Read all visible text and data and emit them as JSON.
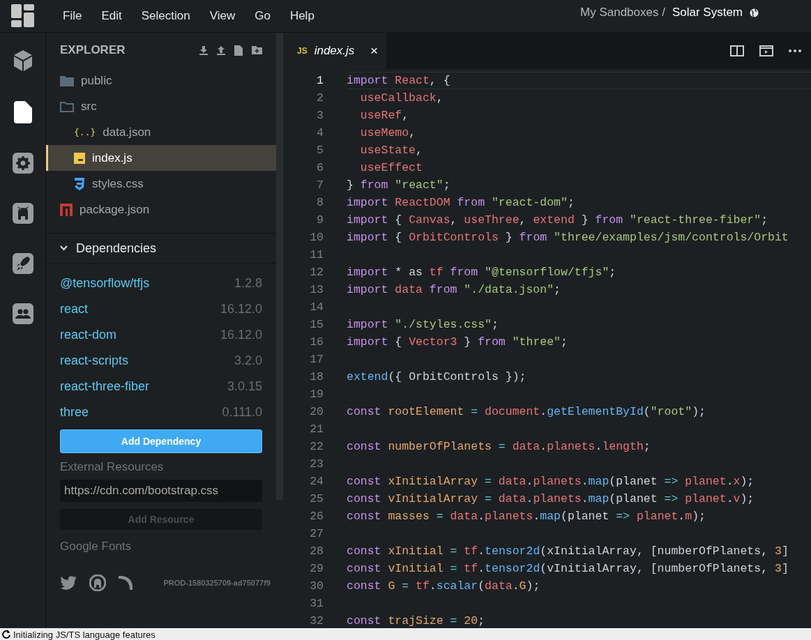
{
  "menu": [
    "File",
    "Edit",
    "Selection",
    "View",
    "Go",
    "Help"
  ],
  "breadcrumb": {
    "parent": "My Sandboxes /",
    "title": "Solar System"
  },
  "activity_bar": [
    {
      "kind": "cube",
      "selected": false
    },
    {
      "kind": "file",
      "selected": true
    },
    {
      "kind": "gear",
      "selected": false
    },
    {
      "kind": "github",
      "selected": false
    },
    {
      "kind": "rocket",
      "selected": false
    },
    {
      "kind": "people",
      "selected": false
    }
  ],
  "explorer": {
    "title": "EXPLORER",
    "files": [
      {
        "name": "public",
        "kind": "folder",
        "expanded": false,
        "selected": false
      },
      {
        "name": "src",
        "kind": "folder",
        "expanded": true,
        "selected": false,
        "children": [
          {
            "name": "data.json",
            "kind": "json",
            "icon_text": "{..}",
            "selected": false
          },
          {
            "name": "index.js",
            "kind": "js",
            "selected": true
          },
          {
            "name": "styles.css",
            "kind": "css",
            "selected": false
          }
        ]
      },
      {
        "name": "package.json",
        "kind": "npm",
        "selected": false
      }
    ]
  },
  "dependencies": {
    "title": "Dependencies",
    "expanded": true,
    "items": [
      {
        "name": "@tensorflow/tfjs",
        "version": "1.2.8"
      },
      {
        "name": "react",
        "version": "16.12.0"
      },
      {
        "name": "react-dom",
        "version": "16.12.0"
      },
      {
        "name": "react-scripts",
        "version": "3.2.0"
      },
      {
        "name": "react-three-fiber",
        "version": "3.0.15"
      },
      {
        "name": "three",
        "version": "0.111.0"
      }
    ],
    "add_button": "Add Dependency"
  },
  "external_resources": {
    "label": "External Resources",
    "placeholder": "https://cdn.com/bootstrap.css",
    "button": "Add Resource",
    "button_disabled": true
  },
  "google_fonts": "Google Fonts",
  "footer": {
    "version": "PROD-1580325709-ad75077f9"
  },
  "editor": {
    "tab": {
      "icon_text": "JS",
      "name": "index.js",
      "close": "×",
      "selected": true
    },
    "lines": [
      {
        "number": "1",
        "current": true,
        "tokens": [
          {
            "text": "import",
            "kind": "keyword"
          },
          {
            "text": " React",
            "kind": "variable"
          },
          {
            "text": ", {",
            "kind": "plain"
          }
        ]
      },
      {
        "number": "2",
        "current": false,
        "tokens": [
          {
            "text": "  useCallback",
            "kind": "variable"
          },
          {
            "text": ",",
            "kind": "plain"
          }
        ]
      },
      {
        "number": "3",
        "current": false,
        "tokens": [
          {
            "text": "  useRef",
            "kind": "variable"
          },
          {
            "text": ",",
            "kind": "plain"
          }
        ]
      },
      {
        "number": "4",
        "current": false,
        "tokens": [
          {
            "text": "  useMemo",
            "kind": "variable"
          },
          {
            "text": ",",
            "kind": "plain"
          }
        ]
      },
      {
        "number": "5",
        "current": false,
        "tokens": [
          {
            "text": "  useState",
            "kind": "variable"
          },
          {
            "text": ",",
            "kind": "plain"
          }
        ]
      },
      {
        "number": "6",
        "current": false,
        "tokens": [
          {
            "text": "  useEffect",
            "kind": "variable"
          }
        ]
      },
      {
        "number": "7",
        "current": false,
        "tokens": [
          {
            "text": "}",
            "kind": "plain"
          },
          {
            "text": " from",
            "kind": "keyword"
          },
          {
            "text": " \"react\"",
            "kind": "string"
          },
          {
            "text": ";",
            "kind": "plain"
          }
        ]
      },
      {
        "number": "8",
        "current": false,
        "tokens": [
          {
            "text": "import",
            "kind": "keyword"
          },
          {
            "text": " ReactDOM",
            "kind": "variable"
          },
          {
            "text": " from",
            "kind": "keyword"
          },
          {
            "text": " \"react-dom\"",
            "kind": "string"
          },
          {
            "text": ";",
            "kind": "plain"
          }
        ]
      },
      {
        "number": "9",
        "current": false,
        "tokens": [
          {
            "text": "import",
            "kind": "keyword"
          },
          {
            "text": " {",
            "kind": "plain"
          },
          {
            "text": " Canvas",
            "kind": "variable"
          },
          {
            "text": ",",
            "kind": "plain"
          },
          {
            "text": " useThree",
            "kind": "variable"
          },
          {
            "text": ",",
            "kind": "plain"
          },
          {
            "text": " extend",
            "kind": "variable"
          },
          {
            "text": " }",
            "kind": "plain"
          },
          {
            "text": " from",
            "kind": "keyword"
          },
          {
            "text": " \"react-three-fiber\"",
            "kind": "string"
          },
          {
            "text": ";",
            "kind": "plain"
          }
        ]
      },
      {
        "number": "10",
        "current": false,
        "tokens": [
          {
            "text": "import",
            "kind": "keyword"
          },
          {
            "text": " {",
            "kind": "plain"
          },
          {
            "text": " OrbitControls",
            "kind": "variable"
          },
          {
            "text": " }",
            "kind": "plain"
          },
          {
            "text": " from",
            "kind": "keyword"
          },
          {
            "text": " \"three/examples/jsm/controls/Orbit",
            "kind": "string"
          }
        ]
      },
      {
        "number": "11",
        "current": false
      },
      {
        "number": "12",
        "current": false,
        "tokens": [
          {
            "text": "import",
            "kind": "keyword"
          },
          {
            "text": " * as",
            "kind": "plain"
          },
          {
            "text": " tf",
            "kind": "variable"
          },
          {
            "text": " from",
            "kind": "keyword"
          },
          {
            "text": " \"@tensorflow/tfjs\"",
            "kind": "string"
          },
          {
            "text": ";",
            "kind": "plain"
          }
        ]
      },
      {
        "number": "13",
        "current": false,
        "tokens": [
          {
            "text": "import",
            "kind": "keyword"
          },
          {
            "text": " data",
            "kind": "variable"
          },
          {
            "text": " from",
            "kind": "keyword"
          },
          {
            "text": " \"./data.json\"",
            "kind": "string"
          },
          {
            "text": ";",
            "kind": "plain"
          }
        ]
      },
      {
        "number": "14",
        "current": false
      },
      {
        "number": "15",
        "current": false,
        "tokens": [
          {
            "text": "import",
            "kind": "keyword"
          },
          {
            "text": " \"./styles.css\"",
            "kind": "string"
          },
          {
            "text": ";",
            "kind": "plain"
          }
        ]
      },
      {
        "number": "16",
        "current": false,
        "tokens": [
          {
            "text": "import",
            "kind": "keyword"
          },
          {
            "text": " {",
            "kind": "plain"
          },
          {
            "text": " Vector3",
            "kind": "variable"
          },
          {
            "text": " }",
            "kind": "plain"
          },
          {
            "text": " from",
            "kind": "keyword"
          },
          {
            "text": " \"three\"",
            "kind": "string"
          },
          {
            "text": ";",
            "kind": "plain"
          }
        ]
      },
      {
        "number": "17",
        "current": false
      },
      {
        "number": "18",
        "current": false,
        "tokens": [
          {
            "text": "extend",
            "kind": "function"
          },
          {
            "text": "({ OrbitControls });",
            "kind": "plain"
          }
        ]
      },
      {
        "number": "19",
        "current": false
      },
      {
        "number": "20",
        "current": false,
        "tokens": [
          {
            "text": "const",
            "kind": "keyword"
          },
          {
            "text": " rootElement",
            "kind": "constant"
          },
          {
            "text": " =",
            "kind": "operator"
          },
          {
            "text": " document",
            "kind": "variable"
          },
          {
            "text": ".",
            "kind": "plain"
          },
          {
            "text": "getElementById",
            "kind": "function"
          },
          {
            "text": "(",
            "kind": "plain"
          },
          {
            "text": "\"root\"",
            "kind": "string"
          },
          {
            "text": ");",
            "kind": "plain"
          }
        ]
      },
      {
        "number": "21",
        "current": false
      },
      {
        "number": "22",
        "current": false,
        "tokens": [
          {
            "text": "const",
            "kind": "keyword"
          },
          {
            "text": " numberOfPlanets",
            "kind": "constant"
          },
          {
            "text": " =",
            "kind": "operator"
          },
          {
            "text": " data",
            "kind": "variable"
          },
          {
            "text": ".",
            "kind": "plain"
          },
          {
            "text": "planets",
            "kind": "variable"
          },
          {
            "text": ".",
            "kind": "plain"
          },
          {
            "text": "length",
            "kind": "variable"
          },
          {
            "text": ";",
            "kind": "plain"
          }
        ]
      },
      {
        "number": "23",
        "current": false
      },
      {
        "number": "24",
        "current": false,
        "tokens": [
          {
            "text": "const",
            "kind": "keyword"
          },
          {
            "text": " xInitialArray",
            "kind": "constant"
          },
          {
            "text": " =",
            "kind": "operator"
          },
          {
            "text": " data",
            "kind": "variable"
          },
          {
            "text": ".",
            "kind": "plain"
          },
          {
            "text": "planets",
            "kind": "variable"
          },
          {
            "text": ".",
            "kind": "plain"
          },
          {
            "text": "map",
            "kind": "function"
          },
          {
            "text": "(planet",
            "kind": "plain"
          },
          {
            "text": " =>",
            "kind": "operator"
          },
          {
            "text": " planet",
            "kind": "variable"
          },
          {
            "text": ".",
            "kind": "plain"
          },
          {
            "text": "x",
            "kind": "variable"
          },
          {
            "text": ");",
            "kind": "plain"
          }
        ]
      },
      {
        "number": "25",
        "current": false,
        "tokens": [
          {
            "text": "const",
            "kind": "keyword"
          },
          {
            "text": " vInitialArray",
            "kind": "constant"
          },
          {
            "text": " =",
            "kind": "operator"
          },
          {
            "text": " data",
            "kind": "variable"
          },
          {
            "text": ".",
            "kind": "plain"
          },
          {
            "text": "planets",
            "kind": "variable"
          },
          {
            "text": ".",
            "kind": "plain"
          },
          {
            "text": "map",
            "kind": "function"
          },
          {
            "text": "(planet",
            "kind": "plain"
          },
          {
            "text": " =>",
            "kind": "operator"
          },
          {
            "text": " planet",
            "kind": "variable"
          },
          {
            "text": ".",
            "kind": "plain"
          },
          {
            "text": "v",
            "kind": "variable"
          },
          {
            "text": ");",
            "kind": "plain"
          }
        ]
      },
      {
        "number": "26",
        "current": false,
        "tokens": [
          {
            "text": "const",
            "kind": "keyword"
          },
          {
            "text": " masses",
            "kind": "constant"
          },
          {
            "text": " =",
            "kind": "operator"
          },
          {
            "text": " data",
            "kind": "variable"
          },
          {
            "text": ".",
            "kind": "plain"
          },
          {
            "text": "planets",
            "kind": "variable"
          },
          {
            "text": ".",
            "kind": "plain"
          },
          {
            "text": "map",
            "kind": "function"
          },
          {
            "text": "(planet",
            "kind": "plain"
          },
          {
            "text": " =>",
            "kind": "operator"
          },
          {
            "text": " planet",
            "kind": "variable"
          },
          {
            "text": ".",
            "kind": "plain"
          },
          {
            "text": "m",
            "kind": "variable"
          },
          {
            "text": ");",
            "kind": "plain"
          }
        ]
      },
      {
        "number": "27",
        "current": false
      },
      {
        "number": "28",
        "current": false,
        "tokens": [
          {
            "text": "const",
            "kind": "keyword"
          },
          {
            "text": " xInitial",
            "kind": "constant"
          },
          {
            "text": " =",
            "kind": "operator"
          },
          {
            "text": " tf",
            "kind": "variable"
          },
          {
            "text": ".",
            "kind": "plain"
          },
          {
            "text": "tensor2d",
            "kind": "function"
          },
          {
            "text": "(xInitialArray, [numberOfPlanets,",
            "kind": "plain"
          },
          {
            "text": " 3",
            "kind": "constant"
          },
          {
            "text": "]",
            "kind": "plain"
          }
        ]
      },
      {
        "number": "29",
        "current": false,
        "tokens": [
          {
            "text": "const",
            "kind": "keyword"
          },
          {
            "text": " vInitial",
            "kind": "constant"
          },
          {
            "text": " =",
            "kind": "operator"
          },
          {
            "text": " tf",
            "kind": "variable"
          },
          {
            "text": ".",
            "kind": "plain"
          },
          {
            "text": "tensor2d",
            "kind": "function"
          },
          {
            "text": "(vInitialArray, [numberOfPlanets,",
            "kind": "plain"
          },
          {
            "text": " 3",
            "kind": "constant"
          },
          {
            "text": "]",
            "kind": "plain"
          }
        ]
      },
      {
        "number": "30",
        "current": false,
        "tokens": [
          {
            "text": "const",
            "kind": "keyword"
          },
          {
            "text": " G",
            "kind": "constant"
          },
          {
            "text": " =",
            "kind": "operator"
          },
          {
            "text": " tf",
            "kind": "variable"
          },
          {
            "text": ".",
            "kind": "plain"
          },
          {
            "text": "scalar",
            "kind": "function"
          },
          {
            "text": "(",
            "kind": "plain"
          },
          {
            "text": "data",
            "kind": "variable"
          },
          {
            "text": ".",
            "kind": "plain"
          },
          {
            "text": "G",
            "kind": "constant"
          },
          {
            "text": ");",
            "kind": "plain"
          }
        ]
      },
      {
        "number": "31",
        "current": false
      },
      {
        "number": "32",
        "current": false,
        "tokens": [
          {
            "text": "const",
            "kind": "keyword"
          },
          {
            "text": " trajSize",
            "kind": "constant"
          },
          {
            "text": " =",
            "kind": "operator"
          },
          {
            "text": " 20",
            "kind": "constant"
          },
          {
            "text": ";",
            "kind": "plain"
          }
        ]
      }
    ]
  },
  "status_bar": {
    "text": "Initializing JS/TS language features"
  }
}
